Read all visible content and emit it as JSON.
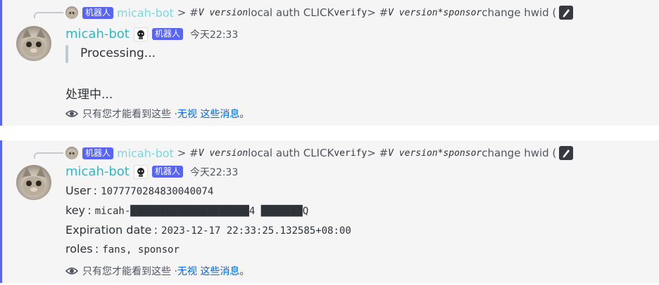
{
  "messages": [
    {
      "reply": {
        "tag": "机器人",
        "name": "micah-bot",
        "t1": "> # ",
        "t2": "V version",
        "t3": " local auth CLICK ",
        "t4": "verify",
        "t5": " > # ",
        "t6": "V version",
        "t7": " ",
        "t8": "*sponsor",
        "t9": " change hwid ("
      },
      "author": "micah-bot",
      "tag": "机器人",
      "timestamp": "今天22:33",
      "quote": "Processing...",
      "body": "处理中...",
      "ephemeral": {
        "text": "只有您才能看到这些 · ",
        "link": "无视 这些消息",
        "end": "。"
      }
    },
    {
      "reply": {
        "tag": "机器人",
        "name": "micah-bot",
        "t1": "> # ",
        "t2": "V version",
        "t3": " local auth CLICK ",
        "t4": "verify",
        "t5": " > # ",
        "t6": "V version",
        "t7": " ",
        "t8": "*sponsor",
        "t9": " change hwid ("
      },
      "author": "micah-bot",
      "tag": "机器人",
      "timestamp": "今天22:33",
      "fields": [
        {
          "key": "User : ",
          "value": "1077770284830040074"
        },
        {
          "key": "key : ",
          "value": "micah-████████████████████4 ███████Q"
        },
        {
          "key": "Expiration date : ",
          "value": "2023-12-17 22:33:25.132585+08:00"
        },
        {
          "key": "roles : ",
          "value": "fans, sponsor"
        }
      ],
      "ephemeral": {
        "text": "只有您才能看到这些 · ",
        "link": "无视 这些消息",
        "end": "。"
      }
    }
  ],
  "colors": {
    "accent": "#5865f2",
    "username": "#2fb9c7",
    "link": "#0068e0",
    "bg": "#f5f5f6"
  }
}
